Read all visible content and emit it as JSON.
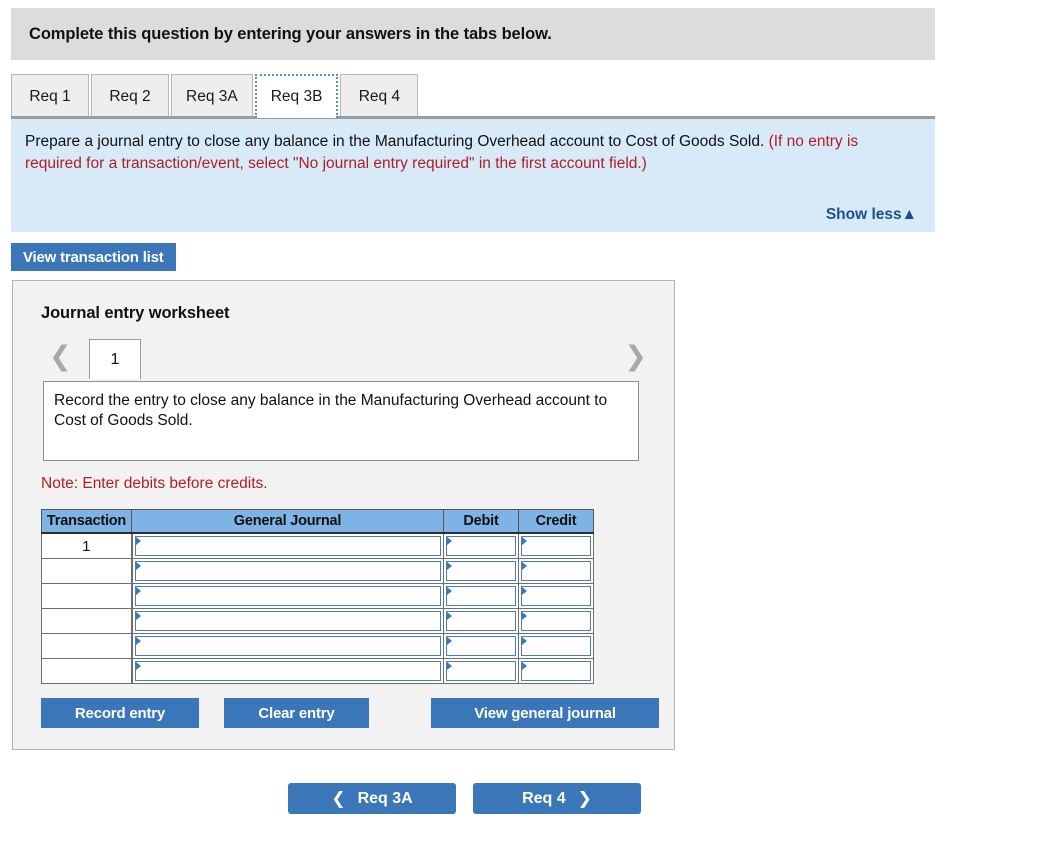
{
  "header": {
    "title": "Complete this question by entering your answers in the tabs below."
  },
  "tabs": {
    "items": [
      {
        "label": "Req 1",
        "active": false
      },
      {
        "label": "Req 2",
        "active": false
      },
      {
        "label": "Req 3A",
        "active": false
      },
      {
        "label": "Req 3B",
        "active": true
      },
      {
        "label": "Req 4",
        "active": false
      }
    ]
  },
  "instructions": {
    "main_text": "Prepare a journal entry to close any balance in the Manufacturing Overhead account to Cost of Goods Sold. ",
    "red_text": "(If no entry is required for a transaction/event, select \"No journal entry required\" in the first account field.)",
    "show_less_label": "Show less",
    "show_less_icon": "▲"
  },
  "toolbar": {
    "view_transaction_list_label": "View transaction list"
  },
  "worksheet": {
    "title": "Journal entry worksheet",
    "pager": {
      "prev_icon": "❮",
      "next_icon": "❯",
      "current_page": "1"
    },
    "description": "Record the entry to close any balance in the Manufacturing Overhead account to Cost of Goods Sold.",
    "note": "Note: Enter debits before credits.",
    "table": {
      "columns": [
        "Transaction",
        "General Journal",
        "Debit",
        "Credit"
      ],
      "rows": [
        {
          "transaction": "1",
          "general_journal": "",
          "debit": "",
          "credit": ""
        },
        {
          "transaction": "",
          "general_journal": "",
          "debit": "",
          "credit": ""
        },
        {
          "transaction": "",
          "general_journal": "",
          "debit": "",
          "credit": ""
        },
        {
          "transaction": "",
          "general_journal": "",
          "debit": "",
          "credit": ""
        },
        {
          "transaction": "",
          "general_journal": "",
          "debit": "",
          "credit": ""
        },
        {
          "transaction": "",
          "general_journal": "",
          "debit": "",
          "credit": ""
        }
      ]
    },
    "actions": {
      "record_entry_label": "Record entry",
      "clear_entry_label": "Clear entry",
      "view_general_journal_label": "View general journal"
    }
  },
  "bottom_nav": {
    "prev_label": "Req 3A",
    "prev_icon": "❮",
    "next_label": "Req 4",
    "next_icon": "❯"
  },
  "colors": {
    "accent_blue": "#3b76b8",
    "table_header_blue": "#7fb2e5",
    "instruction_panel_blue": "#d8eaf8",
    "header_gray": "#dcdcdc",
    "alert_red": "#b01f24",
    "link_navy": "#1c4e8c"
  }
}
